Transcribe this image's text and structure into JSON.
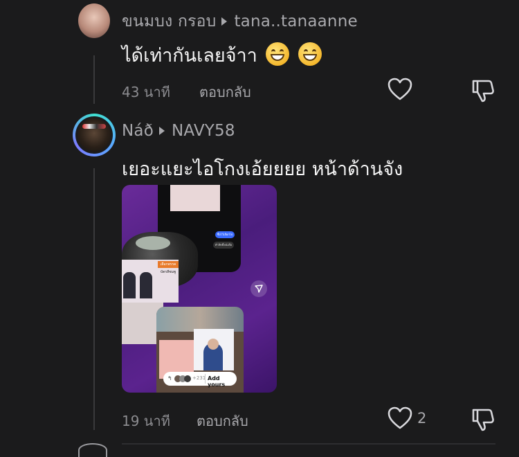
{
  "comments": [
    {
      "author": "ขนมบง กรอบ",
      "reply_to": "tana..tanaanne",
      "text": "ได้เท่ากันเลยจ้าา",
      "time": "43 นาที",
      "reply_label": "ตอบกลับ",
      "like_count": ""
    },
    {
      "author": "Náð",
      "reply_to": "NAVY58",
      "text": "เยอะแยะไอโกงเอ้ยยยย หน้าด้านจัง",
      "time": "19 นาที",
      "reply_label": "ตอบกลับ",
      "like_count": "2",
      "media": {
        "add_yours_label": "Add yours",
        "add_yours_count": "+231",
        "tag_1": "ซื้อไว้เลือกไป",
        "tag_2": "ทำสิทธิ์หนังสือ",
        "poster_text": "เลือกพรรค",
        "poster_text_2": "บัตรสีชมพู"
      }
    }
  ],
  "colors": {
    "background": "#1b1b1c",
    "text_primary": "#f5f5f5",
    "text_secondary": "#a9a9ad",
    "avatar_ring_start": "#3fe0d0",
    "avatar_ring_end": "#7b7bff"
  },
  "icons": [
    "heart-icon",
    "dislike-icon",
    "send-icon"
  ]
}
